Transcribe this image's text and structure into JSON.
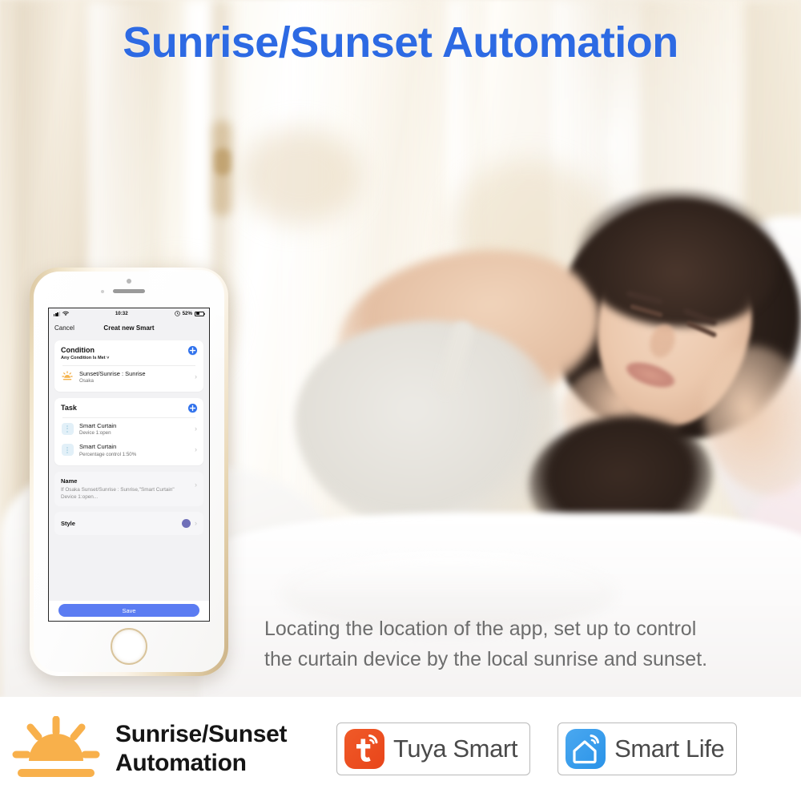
{
  "headline": "Sunrise/Sunset Automation",
  "description": {
    "line1": "Locating the location of the app, set up to control",
    "line2": "the curtain device by the local sunrise and sunset."
  },
  "colors": {
    "headline_blue": "#2d6ae3",
    "accent_blue": "#2f71ec",
    "save_blue": "#5b7cf2",
    "style_purple": "#6f6fb8",
    "sun_orange": "#f8b04b",
    "tuya_orange": "#ef5523",
    "smartlife_blue": "#3c9fec"
  },
  "phone": {
    "status_bar": {
      "signal": "signal-bars-icon",
      "wifi": "wifi-icon",
      "time": "10:32",
      "alarm": "alarm-icon",
      "battery_percent": "52%",
      "battery": "battery-icon"
    },
    "nav": {
      "cancel_label": "Cancel",
      "title": "Creat new Smart"
    },
    "condition_card": {
      "title": "Condition",
      "subtitle": "Any Condition Is Met ˅",
      "add_label": "+",
      "rows": [
        {
          "icon": "sunrise-icon",
          "primary": "Sunset/Sunrise : Sunrise",
          "secondary": "Osaka",
          "chevron": "›"
        }
      ]
    },
    "task_card": {
      "title": "Task",
      "add_label": "+",
      "rows": [
        {
          "icon": "smart-curtain-icon",
          "primary": "Smart Curtain",
          "secondary": "Device 1:open",
          "chevron": "›"
        },
        {
          "icon": "smart-curtain-icon",
          "primary": "Smart Curtain",
          "secondary": "Percentage control 1:50%",
          "chevron": "›"
        }
      ]
    },
    "name_card": {
      "title": "Name",
      "value": "If Osaka Sunset/Sunrise : Sunrise,\"Smart Curtain\" Device 1:open...",
      "chevron": "›"
    },
    "style_card": {
      "title": "Style",
      "swatch": "style-color-swatch",
      "chevron": "›"
    },
    "save_button": "Save"
  },
  "brand_bar": {
    "logo_icon": "sunrise-logo-icon",
    "logo_line1": "Sunrise/Sunset",
    "logo_line2": "Automation",
    "badges": [
      {
        "icon": "tuya-app-icon",
        "label": "Tuya Smart"
      },
      {
        "icon": "smart-life-app-icon",
        "label": "Smart Life"
      }
    ]
  }
}
